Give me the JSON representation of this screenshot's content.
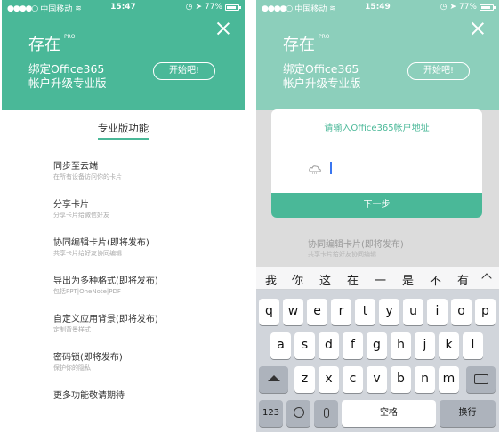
{
  "status_bar": {
    "carrier": "中国移动",
    "battery": "77%",
    "time_left": "15:47",
    "time_right": "15:49"
  },
  "header": {
    "brand": "存在",
    "brand_badge": "PRO",
    "promo_line1": "绑定Office365",
    "promo_line2": "帐户升级专业版",
    "start_button": "开始吧!"
  },
  "features": {
    "title": "专业版功能",
    "items": [
      {
        "title": "同步至云端",
        "subtitle": "在所有设备访问你的卡片"
      },
      {
        "title": "分享卡片",
        "subtitle": "分享卡片给微信好友"
      },
      {
        "title": "协同编辑卡片(即将发布)",
        "subtitle": "共享卡片给好友协同编辑"
      },
      {
        "title": "导出为多种格式(即将发布)",
        "subtitle": "包括PPT|OneNote|PDF"
      },
      {
        "title": "自定义应用背景(即将发布)",
        "subtitle": "定制背景样式"
      },
      {
        "title": "密码锁(即将发布)",
        "subtitle": "保护你的隐私"
      },
      {
        "title": "更多功能敬请期待",
        "subtitle": ""
      }
    ]
  },
  "dialog": {
    "title": "请输入Office365帐户地址",
    "input_value": "",
    "next_button": "下一步"
  },
  "keyboard": {
    "candidates": [
      "我",
      "你",
      "这",
      "在",
      "一",
      "是",
      "不",
      "有"
    ],
    "row1": [
      "q",
      "w",
      "e",
      "r",
      "t",
      "y",
      "u",
      "i",
      "o",
      "p"
    ],
    "row2": [
      "a",
      "s",
      "d",
      "f",
      "g",
      "h",
      "j",
      "k",
      "l"
    ],
    "row3": [
      "z",
      "x",
      "c",
      "v",
      "b",
      "n",
      "m"
    ],
    "num_key": "123",
    "space_key": "空格",
    "return_key": "换行"
  },
  "colors": {
    "accent": "#4ab898",
    "accent_dimmed": "#8ccfbb"
  }
}
